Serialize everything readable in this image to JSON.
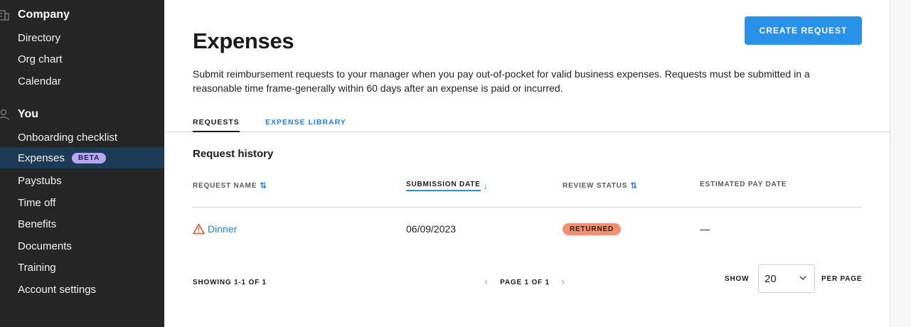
{
  "sidebar": {
    "company": {
      "label": "Company",
      "icon": "building-icon",
      "items": [
        {
          "label": "Directory"
        },
        {
          "label": "Org chart"
        },
        {
          "label": "Calendar"
        }
      ]
    },
    "you": {
      "label": "You",
      "icon": "person-icon",
      "items": [
        {
          "label": "Onboarding checklist"
        },
        {
          "label": "Expenses",
          "badge": "BETA",
          "active": true
        },
        {
          "label": "Paystubs"
        },
        {
          "label": "Time off"
        },
        {
          "label": "Benefits"
        },
        {
          "label": "Documents"
        },
        {
          "label": "Training"
        },
        {
          "label": "Account settings"
        }
      ]
    }
  },
  "main": {
    "title": "Expenses",
    "create_button": "CREATE REQUEST",
    "description": "Submit reimbursement requests to your manager when you pay out-of-pocket for valid business expenses. Requests must be submitted in a reasonable time frame-generally within 60 days after an expense is paid or incurred.",
    "tabs": [
      {
        "label": "REQUESTS",
        "active": true
      },
      {
        "label": "EXPENSE LIBRARY",
        "active": false
      }
    ],
    "section_title": "Request history",
    "table": {
      "columns": [
        "REQUEST NAME",
        "SUBMISSION DATE",
        "REVIEW STATUS",
        "ESTIMATED PAY DATE"
      ],
      "sorted_column": "SUBMISSION DATE",
      "rows": [
        {
          "name": "Dinner",
          "icon": "warning-icon",
          "submission_date": "06/09/2023",
          "status": "RETURNED",
          "estimated_pay_date": "—"
        }
      ]
    },
    "pagination": {
      "showing": "SHOWING 1-1 OF 1",
      "page": "PAGE 1 OF 1",
      "show_label": "SHOW",
      "per_page_value": "20",
      "per_page_label": "PER PAGE"
    }
  },
  "colors": {
    "sidebar_bg": "#262626",
    "sidebar_active": "#1d3b57",
    "accent": "#2a91e8",
    "link": "#2a7fd4",
    "beta_badge": "#b8a6f2",
    "returned_badge": "#f08f72",
    "warning": "#d9582c"
  }
}
